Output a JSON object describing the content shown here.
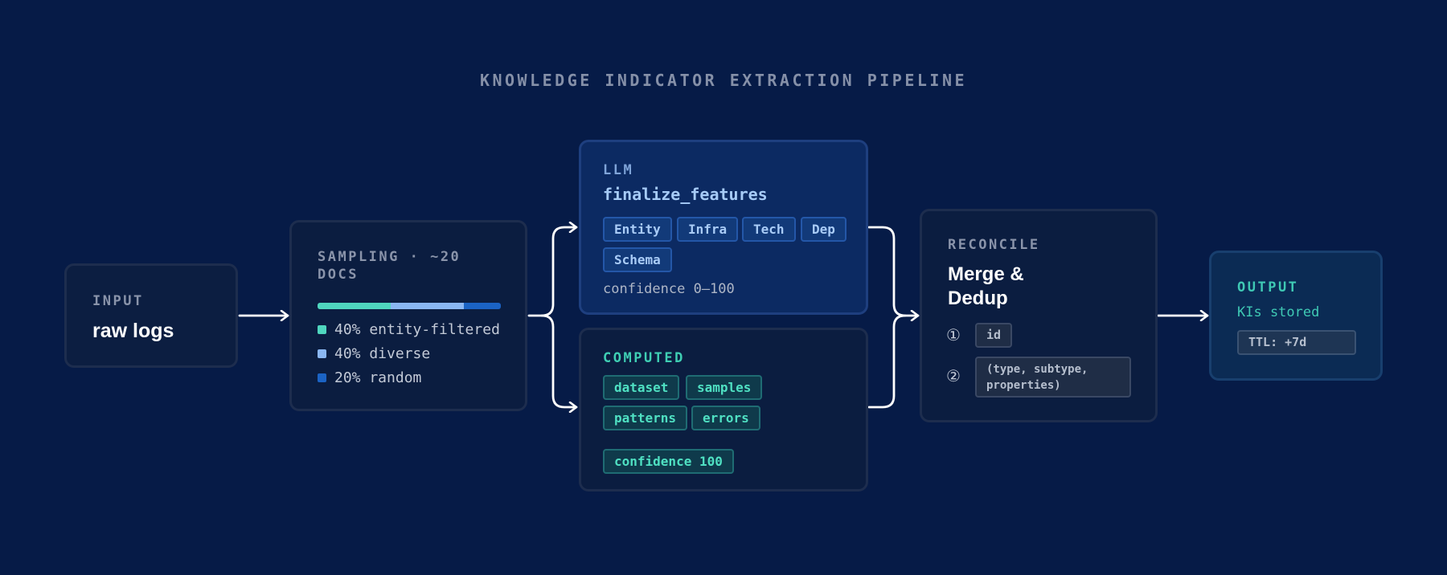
{
  "title": "KNOWLEDGE INDICATOR EXTRACTION PIPELINE",
  "colors": {
    "background": "#061b47",
    "teal": "#4fd6be",
    "light_blue": "#8ab7f2",
    "blue": "#1b63c4",
    "llm_accent": "#9fc6f7",
    "computed_accent": "#3fcfb4"
  },
  "input": {
    "kicker": "INPUT",
    "heading": "raw logs"
  },
  "sampling": {
    "kicker_line1": "SAMPLING · ~20",
    "kicker_line2": "DOCS",
    "distribution": [
      {
        "pct": 40,
        "label": "40% entity-filtered",
        "color": "#4fd6be"
      },
      {
        "pct": 40,
        "label": "40% diverse",
        "color": "#8ab7f2"
      },
      {
        "pct": 20,
        "label": "20% random",
        "color": "#1b63c4"
      }
    ]
  },
  "llm": {
    "kicker": "LLM",
    "heading": "finalize_features",
    "tags": [
      "Entity",
      "Infra",
      "Tech",
      "Dep",
      "Schema"
    ],
    "confidence": "confidence 0–100"
  },
  "computed": {
    "kicker": "COMPUTED",
    "tags": [
      "dataset",
      "samples",
      "patterns",
      "errors"
    ],
    "confidence": "confidence 100"
  },
  "reconcile": {
    "kicker": "RECONCILE",
    "heading_line1": "Merge &",
    "heading_line2": "Dedup",
    "steps": [
      {
        "marker": "①",
        "value": "id"
      },
      {
        "marker": "②",
        "value_line1": "(type, subtype,",
        "value_line2": "properties)"
      }
    ]
  },
  "output": {
    "kicker": "OUTPUT",
    "subtitle": "KIs stored",
    "ttl": "TTL: +7d"
  }
}
